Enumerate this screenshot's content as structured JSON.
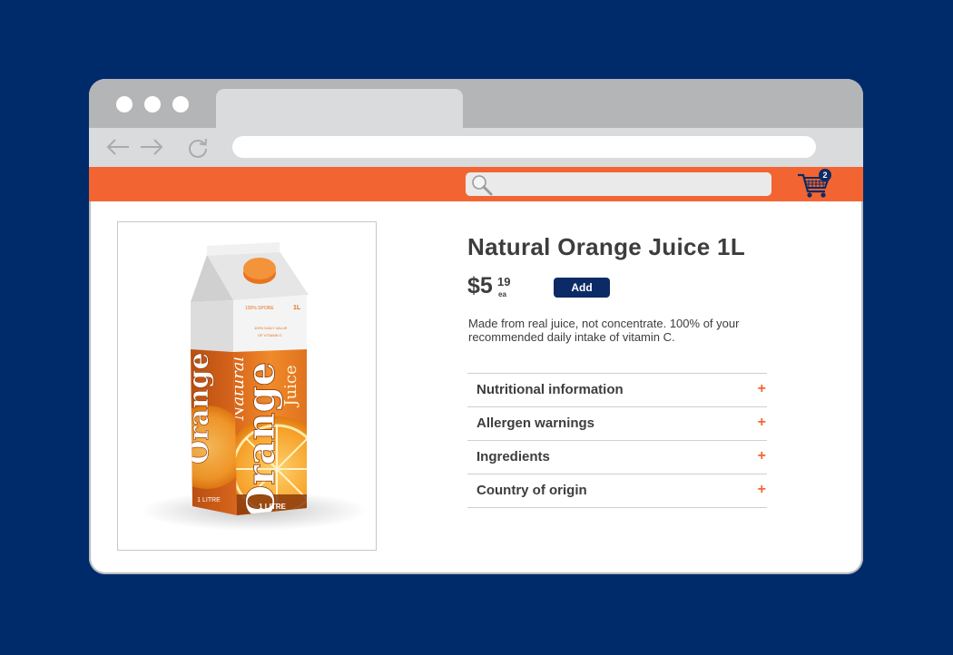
{
  "browser": {
    "nav_icons": [
      "back-arrow-icon",
      "forward-arrow-icon",
      "reload-icon"
    ],
    "window_dots": [
      "dot",
      "dot",
      "dot"
    ]
  },
  "site": {
    "accent_color": "#f26532",
    "brand_color": "#0c2a66",
    "search": {
      "placeholder": "",
      "value": ""
    },
    "cart": {
      "count": "2"
    }
  },
  "product": {
    "title": "Natural Orange Juice 1L",
    "price": {
      "currency": "$",
      "whole": "5",
      "cents": "19",
      "unit": "ea"
    },
    "add_label": "Add",
    "description": "Made from real juice, not concentrate. 100% of your recommended daily intake of vitamin C.",
    "image": {
      "brand_script": "Natural",
      "brand_name": "Orange",
      "brand_sub": "Juice",
      "volume": "1 LITRE",
      "volume_side": "1 LITRE",
      "size_mark": "1L",
      "top_text": "100% SPORE",
      "daily_value": "100% DAILY VALUE",
      "daily_value_sub": "OF VITAMIN C"
    },
    "accordion": [
      {
        "label": "Nutritional information",
        "icon": "+"
      },
      {
        "label": "Allergen warnings",
        "icon": "+"
      },
      {
        "label": "Ingredients",
        "icon": "+"
      },
      {
        "label": "Country of origin",
        "icon": "+"
      }
    ]
  }
}
